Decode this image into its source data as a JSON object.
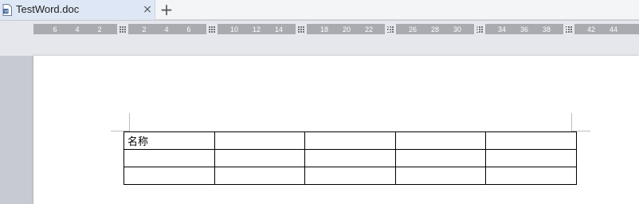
{
  "tabbar": {
    "tab_title": "TestWord.doc",
    "close_symbol": "×",
    "new_tab_symbol": "+"
  },
  "ruler": {
    "ticks": [
      {
        "label": "6"
      },
      {
        "label": "4"
      },
      {
        "label": "2"
      },
      {
        "label": "2"
      },
      {
        "label": "4"
      },
      {
        "label": "6"
      },
      {
        "label": "10"
      },
      {
        "label": "12"
      },
      {
        "label": "14"
      },
      {
        "label": "18"
      },
      {
        "label": "20"
      },
      {
        "label": "22"
      },
      {
        "label": "2"
      },
      {
        "label": "26"
      },
      {
        "label": "28"
      },
      {
        "label": "30"
      },
      {
        "label": "3"
      },
      {
        "label": "34"
      },
      {
        "label": "36"
      },
      {
        "label": "38"
      },
      {
        "label": "4"
      },
      {
        "label": "42"
      },
      {
        "label": "44"
      }
    ]
  },
  "document": {
    "table": {
      "rows": [
        [
          "名称",
          "",
          "",
          "",
          ""
        ],
        [
          "",
          "",
          "",
          "",
          ""
        ],
        [
          "",
          "",
          "",
          "",
          ""
        ]
      ]
    }
  },
  "colors": {
    "tab_active": "#dde7f5",
    "ruler": "#a9abb0",
    "workspace": "#c8cad3",
    "page": "#ffffff"
  }
}
